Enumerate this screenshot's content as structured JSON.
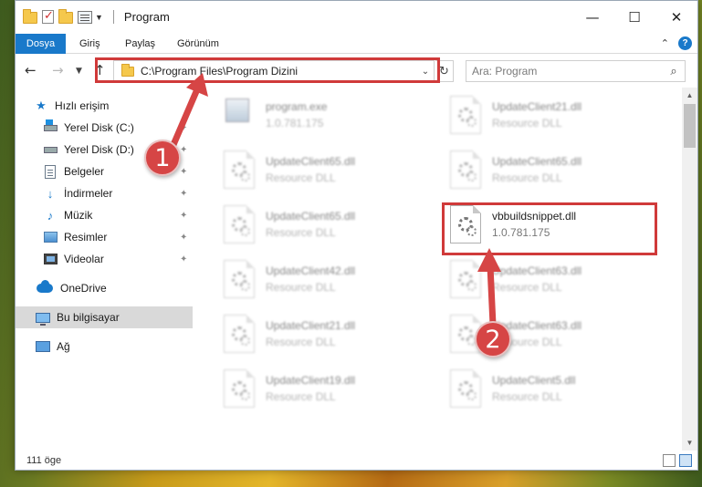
{
  "window": {
    "title": "Program",
    "minimize_glyph": "—",
    "maximize_glyph": "☐",
    "close_glyph": "✕"
  },
  "ribbon": {
    "tabs": [
      "Dosya",
      "Giriş",
      "Paylaş",
      "Görünüm"
    ],
    "collapse_glyph": "⌃",
    "help_glyph": "?"
  },
  "nav": {
    "back_glyph": "←",
    "forward_glyph": "→",
    "recent_glyph": "▼",
    "up_glyph": "↑",
    "address": "C:\\Program Files\\Program Dizini",
    "address_dropdown_glyph": "⌄",
    "refresh_glyph": "↻",
    "search_placeholder": "Ara: Program",
    "search_glyph": "⌕"
  },
  "sidebar": {
    "quick_access": "Hızlı erişim",
    "pin_glyph": "✦",
    "items": [
      {
        "label": "Yerel Disk (C:)",
        "icon": "drive-windows-icon"
      },
      {
        "label": "Yerel Disk (D:)",
        "icon": "drive-icon"
      },
      {
        "label": "Belgeler",
        "icon": "documents-icon"
      },
      {
        "label": "İndirmeler",
        "icon": "downloads-icon"
      },
      {
        "label": "Müzik",
        "icon": "music-icon"
      },
      {
        "label": "Resimler",
        "icon": "pictures-icon"
      },
      {
        "label": "Videolar",
        "icon": "videos-icon"
      }
    ],
    "onedrive": "OneDrive",
    "this_pc": "Bu bilgisayar",
    "network": "Ağ"
  },
  "files": [
    {
      "name": "program.exe",
      "sub": "1.0.781.175"
    },
    {
      "name": "UpdateClient21.dll",
      "sub": "Resource DLL"
    },
    {
      "name": "UpdateClient65.dll",
      "sub": "Resource DLL"
    },
    {
      "name": "UpdateClient65.dll",
      "sub": "Resource DLL"
    },
    {
      "name": "UpdateClient65.dll",
      "sub": "Resource DLL"
    },
    {
      "name": "vbbuildsnippet.dll",
      "sub": "1.0.781.175"
    },
    {
      "name": "UpdateClient42.dll",
      "sub": "Resource DLL"
    },
    {
      "name": "UpdateClient63.dll",
      "sub": "Resource DLL"
    },
    {
      "name": "UpdateClient21.dll",
      "sub": "Resource DLL"
    },
    {
      "name": "UpdateClient63.dll",
      "sub": "Resource DLL"
    },
    {
      "name": "UpdateClient19.dll",
      "sub": "Resource DLL"
    },
    {
      "name": "UpdateClient5.dll",
      "sub": "Resource DLL"
    }
  ],
  "status": {
    "item_count": "111 öge"
  },
  "annotations": {
    "step1": "1",
    "step2": "2",
    "color": "#d03a3a"
  },
  "scrollbar": {
    "up_glyph": "▲",
    "down_glyph": "▼"
  }
}
